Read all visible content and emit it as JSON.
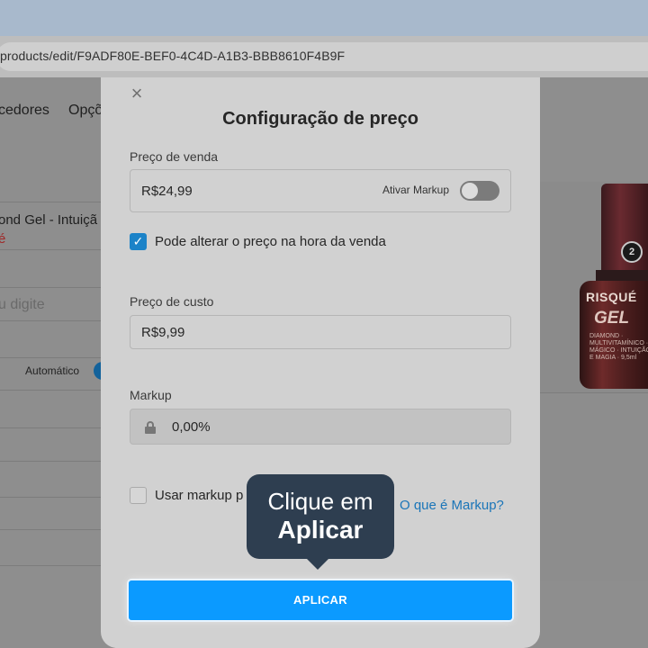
{
  "browser": {
    "url": "products/edit/F9ADF80E-BEF0-4C4D-A1B3-BBB8610F4B9F"
  },
  "background": {
    "nav": [
      "cedores",
      "Opçõ"
    ],
    "product_name_line1": "ond Gel - Intuiçã",
    "product_name_line2": "é",
    "search_placeholder": "u digite",
    "auto_label": "Automático",
    "product_image": {
      "brand": "RISQUÉ",
      "line": "GEL",
      "badge": "2",
      "sub": "DIAMOND · MULTIVITAMÍNICO · MÁGICO · INTUIÇÃO E MAGIA · 9,5ml"
    }
  },
  "modal": {
    "title": "Configuração de preço",
    "close_symbol": "×",
    "sale_price": {
      "label": "Preço de venda",
      "value": "R$24,99",
      "markup_toggle_label": "Ativar Markup",
      "markup_toggle_on": false
    },
    "allow_change_checkbox": {
      "label": "Pode alterar o preço na hora da venda",
      "checked": true,
      "check_symbol": "✓"
    },
    "cost_price": {
      "label": "Preço de custo",
      "value": "R$9,99"
    },
    "markup": {
      "label": "Markup",
      "value": "0,00%"
    },
    "use_markup_checkbox": {
      "label": "Usar markup p",
      "checked": false
    },
    "markup_help_link": "O que é Markup?",
    "apply_button": "APLICAR"
  },
  "tooltip": {
    "line1": "Clique em",
    "line2": "Aplicar"
  },
  "colors": {
    "primary": "#0b9aff",
    "tooltip": "#2e3e50",
    "checkbox": "#1c83c8",
    "link": "#1a75b8"
  }
}
